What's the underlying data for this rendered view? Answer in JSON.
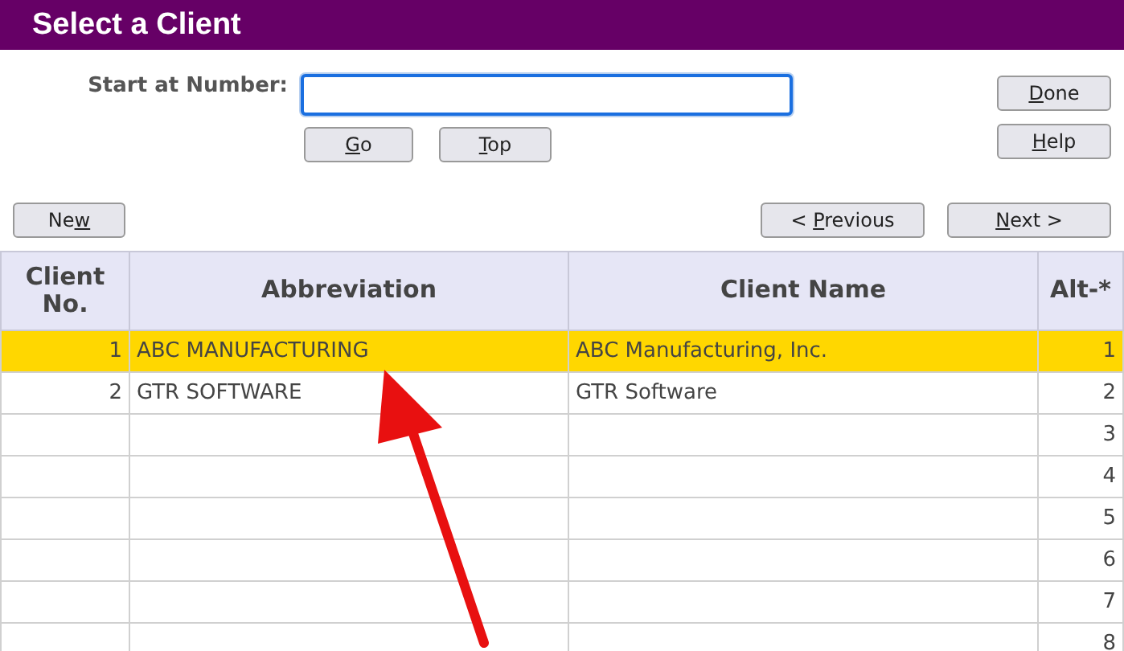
{
  "window": {
    "title": "Select a Client"
  },
  "start_field": {
    "label": "Start at Number:"
  },
  "buttons": {
    "go": {
      "key": "G",
      "post": "o"
    },
    "top": {
      "key": "T",
      "post": "op"
    },
    "done": {
      "key": "D",
      "post": "one"
    },
    "help": {
      "key": "H",
      "post": "elp"
    },
    "new": {
      "pre": "Ne",
      "key": "w"
    },
    "previous": {
      "pre": "< ",
      "key": "P",
      "post": "revious"
    },
    "next": {
      "key": "N",
      "post": "ext >"
    }
  },
  "table": {
    "columns": [
      "Client No.",
      "Abbreviation",
      "Client Name",
      "Alt-*"
    ],
    "rows": [
      {
        "number": "1",
        "abbreviation": "ABC MANUFACTURING",
        "name": "ABC Manufacturing, Inc.",
        "alt": "1",
        "selected": true
      },
      {
        "number": "2",
        "abbreviation": "GTR SOFTWARE",
        "name": "GTR Software",
        "alt": "2",
        "selected": false
      },
      {
        "alt": "3",
        "selected": false
      },
      {
        "alt": "4",
        "selected": false
      },
      {
        "alt": "5",
        "selected": false
      },
      {
        "alt": "6",
        "selected": false
      },
      {
        "alt": "7",
        "selected": false
      },
      {
        "alt": "8",
        "selected": false
      }
    ]
  }
}
